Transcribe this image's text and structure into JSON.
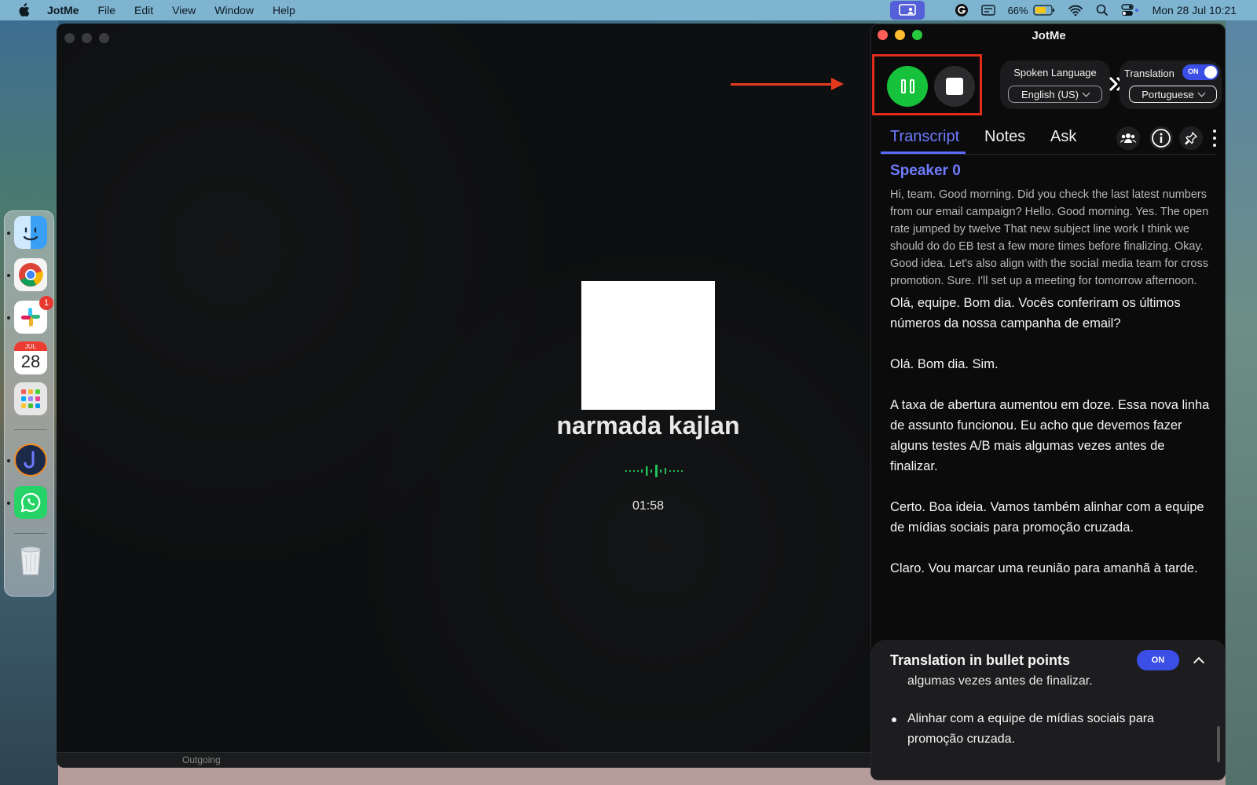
{
  "menubar": {
    "app_name": "JotMe",
    "items": [
      "File",
      "Edit",
      "View",
      "Window",
      "Help"
    ],
    "battery": "66%",
    "clock": "Mon 28 Jul  10:21"
  },
  "dock": {
    "calendar_month": "JUL",
    "calendar_day": "28",
    "slack_badge": "1"
  },
  "call": {
    "caller_name": "narmada kajlan",
    "duration": "01:58",
    "bottom_label": "Outgoing"
  },
  "jotme": {
    "title": "JotMe",
    "spoken_language_label": "Spoken Language",
    "spoken_language_value": "English (US)",
    "translation_label": "Translation",
    "translation_toggle": "ON",
    "translation_language": "Portuguese",
    "tabs": [
      "Transcript",
      "Notes",
      "Ask"
    ],
    "speaker": "Speaker 0",
    "original_text": "Hi, team. Good morning. Did you check the last latest numbers from our email campaign? Hello. Good morning. Yes. The open rate jumped by twelve That new subject line work I think we should do do EB test a few more times before finalizing. Okay. Good idea. Let's also align with the social media team for cross promotion. Sure. I'll set up a meeting for tomorrow afternoon.",
    "translations": [
      "Olá, equipe. Bom dia. Vocês conferiram os últimos números da nossa campanha de email?",
      "Olá. Bom dia. Sim.",
      "A taxa de abertura aumentou em doze. Essa nova linha de assunto funcionou. Eu acho que devemos fazer alguns testes A/B mais algumas vezes antes de finalizar.",
      "Certo. Boa ideia. Vamos também alinhar com a equipe de mídias sociais para promoção cruzada.",
      "Claro. Vou marcar uma reunião para amanhã à tarde."
    ],
    "bullets": {
      "title": "Translation in bullet points",
      "toggle": "ON",
      "partial": "algumas vezes antes de finalizar.",
      "item": "Alinhar com a equipe de mídias sociais para promoção cruzada."
    }
  },
  "colors": {
    "accent": "#6e7cff",
    "record_green": "#16c23c",
    "highlight_red": "#e12b1b"
  }
}
